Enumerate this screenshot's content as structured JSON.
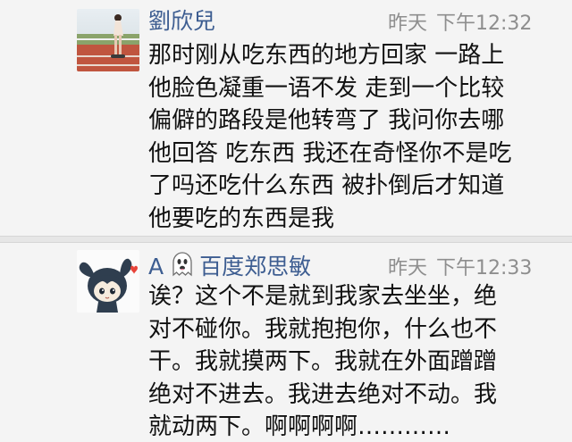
{
  "comments": [
    {
      "author": "劉欣兒",
      "day": "昨天",
      "time": "下午12:32",
      "avatar_icon": "photo-avatar",
      "lines": [
        "那时刚从吃东西的地方回家 一路上",
        "他脸色凝重一语不发 走到一个比较",
        "偏僻的路段是他转弯了 我问你去哪",
        "他回答 吃东西 我还在奇怪你不是吃",
        "了吗还吃什么东西 被扑倒后才知道",
        "他要吃的东西是我"
      ]
    },
    {
      "author_prefix": "A",
      "author_icon": "ghost-emoji-icon",
      "author": "百度郑思敏",
      "day": "昨天",
      "time": "下午12:33",
      "avatar_icon": "cartoon-bunny-avatar",
      "lines": [
        "诶？这个不是就到我家去坐坐，绝",
        "对不碰你。我就抱抱你，什么也不",
        "干。我就摸两下。我就在外面蹭蹭",
        "绝对不进去。我进去绝对不动。我",
        "就动两下。啊啊啊啊…………"
      ]
    }
  ],
  "colors": {
    "author": "#3d5d91",
    "time": "#8e8e8e",
    "text": "#111111",
    "background": "#f4f4f4",
    "heart": "#e8443a"
  }
}
